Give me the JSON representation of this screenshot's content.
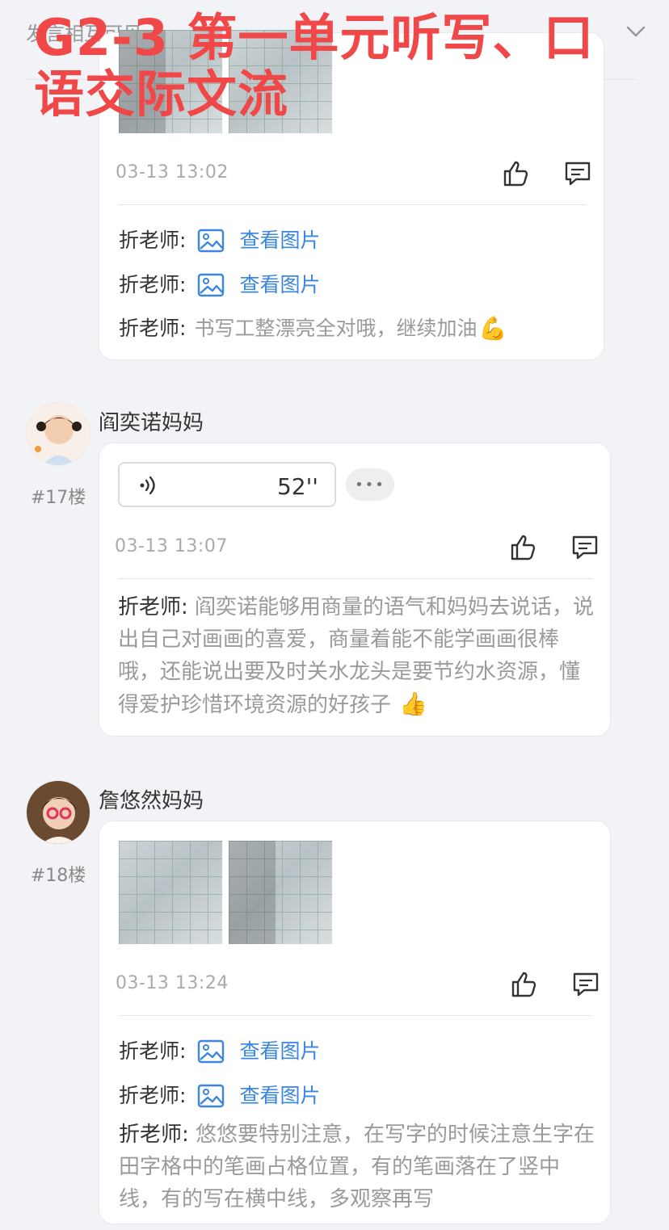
{
  "topbar": {
    "hint": "发言相互可见",
    "overlay_title": "G2-3 第一单元听写、口语交际文流"
  },
  "posts": [
    {
      "time": "03-13 13:02",
      "comments": [
        {
          "author": "折老师:",
          "link": "查看图片"
        },
        {
          "author": "折老师:",
          "link": "查看图片"
        },
        {
          "author": "折老师:",
          "text": "书写工整漂亮全对哦，继续加油",
          "emoji": "💪"
        }
      ]
    },
    {
      "user": "阎奕诺妈妈",
      "floor": "#17楼",
      "voice_duration": "52''",
      "more": "•••",
      "time": "03-13 13:07",
      "comments": [
        {
          "author": "折老师:",
          "text": "阎奕诺能够用商量的语气和妈妈去说话，说出自己对画画的喜爱，商量着能不能学画画很棒哦，还能说出要及时关水龙头是要节约水资源，懂得爱护珍惜环境资源的好孩子",
          "emoji": "👍"
        }
      ]
    },
    {
      "user": "詹悠然妈妈",
      "floor": "#18楼",
      "time": "03-13 13:24",
      "comments": [
        {
          "author": "折老师:",
          "link": "查看图片"
        },
        {
          "author": "折老师:",
          "link": "查看图片"
        },
        {
          "author": "折老师:",
          "text": "悠悠要特别注意，在写字的时候注意生字在田字格中的笔画占格位置，有的笔画落在了竖中线，有的写在横中线，多观察再写"
        }
      ]
    }
  ],
  "colors": {
    "accent": "#3a86e0",
    "overlay": "#f04848",
    "background": "#f2f3f7"
  }
}
